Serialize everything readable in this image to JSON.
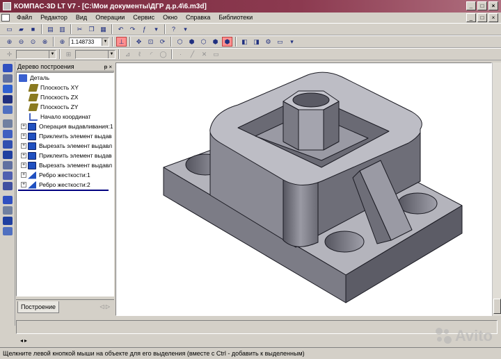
{
  "window": {
    "title": "КОМПАС-3D LT V7 - [C:\\Мои документы\\ДГР д.р.4\\6.m3d]",
    "controls": [
      "_",
      "□",
      "×"
    ]
  },
  "menu": {
    "items": [
      "Файл",
      "Редактор",
      "Вид",
      "Операции",
      "Сервис",
      "Окно",
      "Справка",
      "Библиотеки"
    ],
    "mdi_controls": [
      "_",
      "□",
      "×"
    ]
  },
  "toolbar": {
    "zoom_value": "1.148733",
    "help_glyph": "?"
  },
  "tree_panel": {
    "title": "Дерево построения",
    "controls": "ᵽ ×",
    "items": [
      {
        "label": "Деталь",
        "icon": "detail-icon",
        "expand": ""
      },
      {
        "label": "Плоскость XY",
        "icon": "plane-icon",
        "expand": ""
      },
      {
        "label": "Плоскость ZX",
        "icon": "plane-icon",
        "expand": ""
      },
      {
        "label": "Плоскость ZY",
        "icon": "plane-icon",
        "expand": ""
      },
      {
        "label": "Начало координат",
        "icon": "origin-icon",
        "expand": ""
      },
      {
        "label": "Операция выдавливания:1",
        "icon": "extrude-icon",
        "expand": "+"
      },
      {
        "label": "Приклеить элемент выдав",
        "icon": "extrude-icon",
        "expand": "+"
      },
      {
        "label": "Вырезать элемент выдавл",
        "icon": "extrude-icon",
        "expand": "+"
      },
      {
        "label": "Приклеить элемент выдав",
        "icon": "extrude-icon",
        "expand": "+"
      },
      {
        "label": "Вырезать элемент выдавл",
        "icon": "extrude-icon",
        "expand": "+"
      },
      {
        "label": "Ребро жесткости:1",
        "icon": "rib-icon",
        "expand": "+"
      },
      {
        "label": "Ребро жесткости:2",
        "icon": "rib-icon",
        "expand": "+"
      }
    ],
    "tab_label": "Построение"
  },
  "status": {
    "message": "Щелкните левой кнопкой мыши на объекте для его выделения (вместе с Ctrl - добавить к выделенным)"
  },
  "watermark": "Avito",
  "colors": {
    "title_bar": "#7a2a3e",
    "model_face_top": "#b4b4bc",
    "model_face_side": "#7c7c86",
    "model_face_dark": "#5c5c66"
  }
}
